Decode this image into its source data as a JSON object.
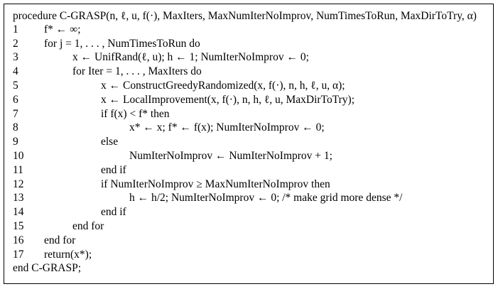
{
  "algorithm": {
    "header": "procedure C-GRASP(n, ℓ, u, f(·), MaxIters, MaxNumIterNoImprov, NumTimesToRun, MaxDirToTry, α)",
    "footer": "end C-GRASP;",
    "lines": [
      {
        "num": "1",
        "text": "f* ← ∞;"
      },
      {
        "num": "2",
        "text": "for j = 1, . . . , NumTimesToRun do"
      },
      {
        "num": "3",
        "text": "x ← UnifRand(ℓ, u); h ← 1; NumIterNoImprov ← 0;"
      },
      {
        "num": "4",
        "text": "for Iter = 1, . . . , MaxIters do"
      },
      {
        "num": "5",
        "text": "x ← ConstructGreedyRandomized(x, f(·), n, h, ℓ, u, α);"
      },
      {
        "num": "6",
        "text": "x ← LocalImprovement(x, f(·), n, h, ℓ, u, MaxDirToTry);"
      },
      {
        "num": "7",
        "text": "if f(x) < f* then"
      },
      {
        "num": "8",
        "text": "x* ← x; f* ← f(x); NumIterNoImprov ← 0;"
      },
      {
        "num": "9",
        "text": "else"
      },
      {
        "num": "10",
        "text": "NumIterNoImprov ← NumIterNoImprov + 1;"
      },
      {
        "num": "11",
        "text": "end if"
      },
      {
        "num": "12",
        "text": "if NumIterNoImprov ≥ MaxNumIterNoImprov then"
      },
      {
        "num": "13",
        "text": "h ← h/2; NumIterNoImprov ← 0;      /* make grid more dense */"
      },
      {
        "num": "14",
        "text": "end if"
      },
      {
        "num": "15",
        "text": "end for"
      },
      {
        "num": "16",
        "text": "end for"
      },
      {
        "num": "17",
        "text": "return(x*);"
      }
    ]
  }
}
